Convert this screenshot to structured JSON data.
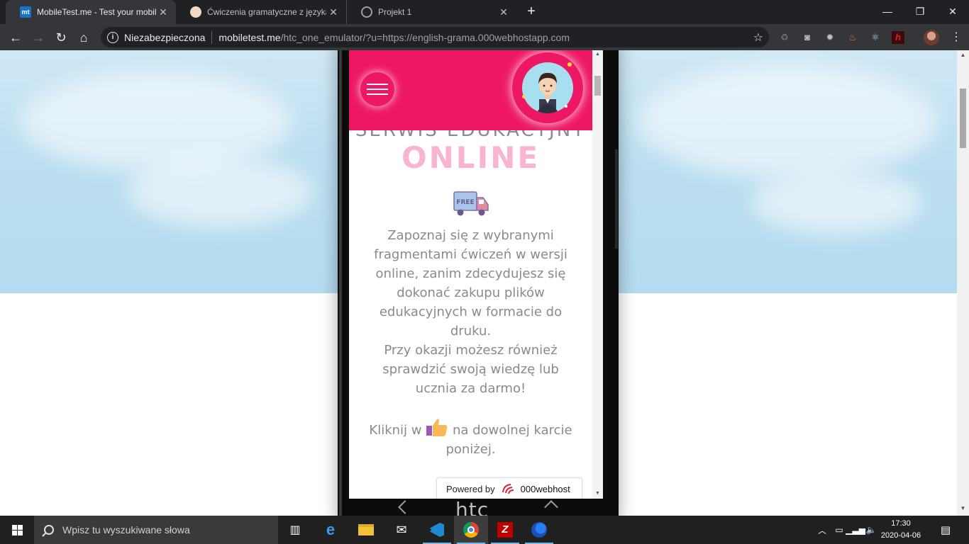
{
  "browser": {
    "tabs": [
      {
        "title": "MobileTest.me - Test your mobile",
        "favicon": "mt",
        "active": true
      },
      {
        "title": "Ćwiczenia gramatyczne z języka a",
        "favicon": "cake-icon",
        "active": false
      },
      {
        "title": "Projekt 1",
        "favicon": "globe-icon",
        "active": false
      }
    ],
    "new_tab_label": "+",
    "window_controls": {
      "minimize": "—",
      "restore": "❐",
      "close": "✕"
    },
    "security_label": "Niezabezpieczona",
    "url_host": "mobiletest.me",
    "url_path": "/htc_one_emulator/?u=https://english-grama.000webhostapp.com",
    "extensions": [
      "recycle-icon",
      "camera-icon",
      "gear-icon",
      "fire-icon",
      "react-icon",
      "h-icon"
    ]
  },
  "site": {
    "title_top": "SERWIS EDUKACYJNY",
    "title_main": "ONLINE",
    "truck_label": "FREE",
    "description_lines": [
      "Zapoznaj się z wybranymi",
      "fragmentami ćwiczeń w wersji",
      "online, zanim zdecydujesz się",
      "dokonać zakupu plików",
      "edukacyjnych w formacie do",
      "druku.",
      "Przy okazji możesz również",
      "sprawdzić swoją wiedzę lub",
      "ucznia za darmo!"
    ],
    "click_before": "Kliknij w",
    "click_after": "na dowolnej karcie",
    "click_line2": "poniżej.",
    "powered_by": "Powered by",
    "powered_brand": "000webhost",
    "accent_color": "#ee1764"
  },
  "emulator": {
    "brand": "htc"
  },
  "taskbar": {
    "search_placeholder": "Wpisz tu wyszukiwane słowa",
    "apps": [
      "task-view-icon",
      "edge-icon",
      "file-explorer-icon",
      "mail-icon",
      "vscode-icon",
      "chrome-icon",
      "filezilla-icon",
      "firefox-icon"
    ],
    "time": "17:30",
    "date": "2020-04-06"
  }
}
